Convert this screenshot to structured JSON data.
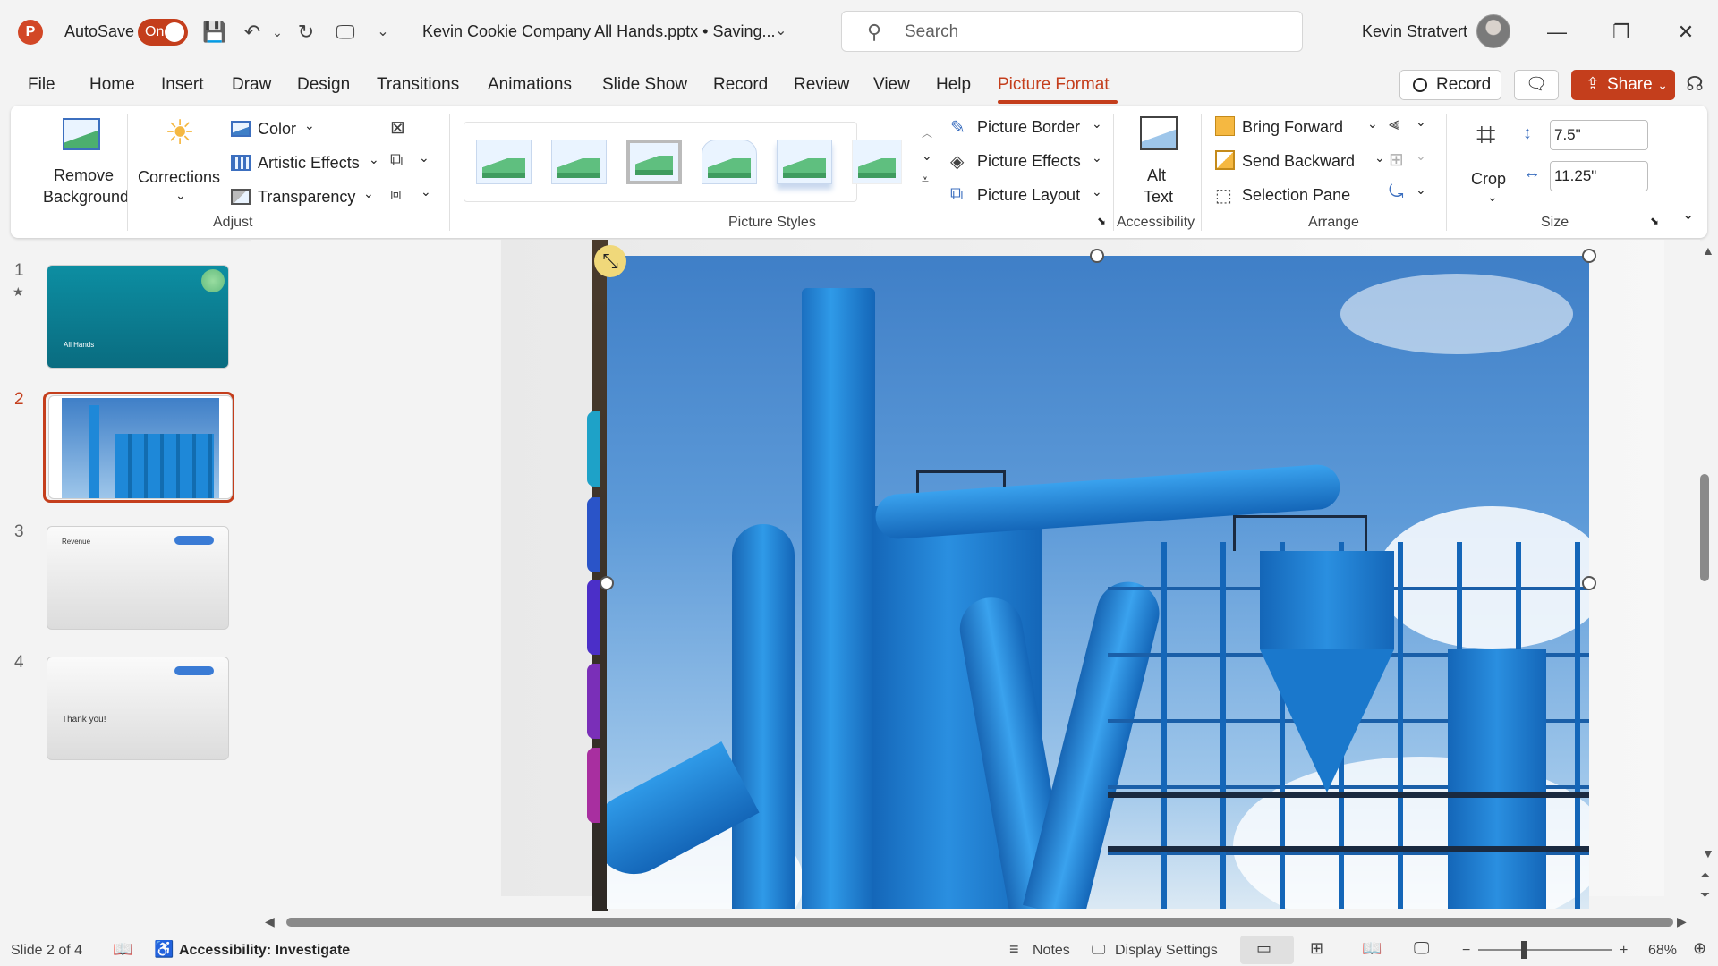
{
  "app": {
    "logo_letter": "P",
    "autosave_label": "AutoSave",
    "autosave_state": "On",
    "document_title": "Kevin Cookie Company All Hands.pptx • Saving...",
    "search_placeholder": "Search",
    "user_name": "Kevin Stratvert"
  },
  "icons": {
    "save": "💾",
    "undo": "↶",
    "redo": "↻",
    "present": "🖵",
    "customize": "⌄",
    "search": "⚲",
    "minimize": "—",
    "restore": "❐",
    "close": "✕",
    "comment": "🗨",
    "copilot": "☊",
    "chevron": "⌄",
    "corrections": "☀",
    "sun_color": "#f5b841"
  },
  "menu": {
    "tabs": [
      "File",
      "Home",
      "Insert",
      "Draw",
      "Design",
      "Transitions",
      "Animations",
      "Slide Show",
      "Record",
      "Review",
      "View",
      "Help",
      "Picture Format"
    ],
    "active_tab": "Picture Format",
    "record_button": "Record",
    "share_button": "Share"
  },
  "ribbon": {
    "adjust": {
      "remove_background": [
        "Remove",
        "Background"
      ],
      "corrections": "Corrections",
      "color": "Color",
      "artistic_effects": "Artistic Effects",
      "transparency": "Transparency",
      "label": "Adjust"
    },
    "picture_styles": {
      "label": "Picture Styles",
      "picture_border": "Picture Border",
      "picture_effects": "Picture Effects",
      "picture_layout": "Picture Layout"
    },
    "accessibility": {
      "alt_text": [
        "Alt",
        "Text"
      ],
      "label": "Accessibility"
    },
    "arrange": {
      "bring_forward": "Bring Forward",
      "send_backward": "Send Backward",
      "selection_pane": "Selection Pane",
      "label": "Arrange"
    },
    "size": {
      "crop": "Crop",
      "height": "7.5\"",
      "width": "11.25\"",
      "label": "Size"
    }
  },
  "slides": [
    {
      "number": "1",
      "title": "All Hands"
    },
    {
      "number": "2",
      "title": ""
    },
    {
      "number": "3",
      "title": "Revenue"
    },
    {
      "number": "4",
      "title": "Thank you!"
    }
  ],
  "selected_slide": "2",
  "status": {
    "slide_info": "Slide 2 of 4",
    "accessibility": "Accessibility: Investigate",
    "notes": "Notes",
    "display_settings": "Display Settings",
    "zoom": "68%"
  },
  "colors": {
    "accent": "#c43e1c",
    "ribbon_bg": "#ffffff",
    "teal_slide": "#0f8fa0"
  }
}
